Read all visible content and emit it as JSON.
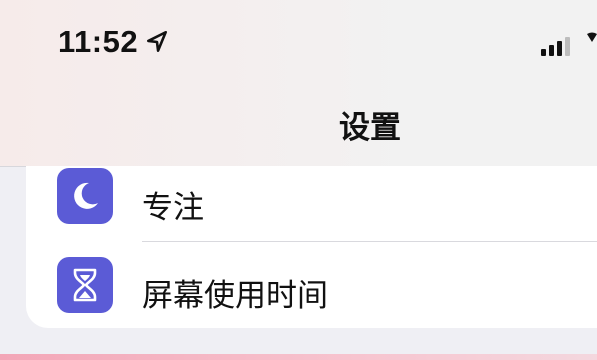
{
  "status_bar": {
    "time": "11:52",
    "location_icon": "location-arrow-icon",
    "signal_icon": "cellular-signal-icon"
  },
  "nav": {
    "title": "设置"
  },
  "settings": {
    "items": [
      {
        "label": "专注",
        "icon": "moon-icon",
        "icon_bg": "#5b5bd6"
      },
      {
        "label": "屏幕使用时间",
        "icon": "hourglass-icon",
        "icon_bg": "#5b5bd6"
      }
    ]
  },
  "colors": {
    "background": "#efeff4",
    "card": "#ffffff",
    "accent_purple": "#5b5bd6",
    "accent_pink": "#f3a6b7"
  }
}
